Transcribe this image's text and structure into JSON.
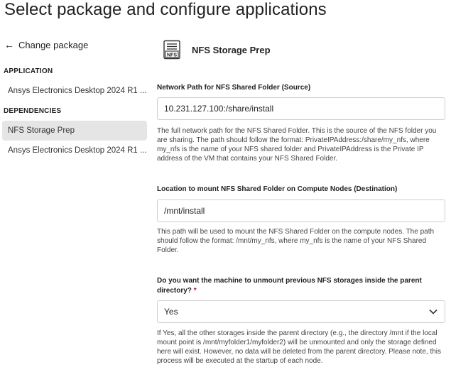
{
  "page": {
    "title": "Select package and configure applications"
  },
  "sidebar": {
    "back": {
      "label": "Change package",
      "icon": "arrow-left-icon"
    },
    "application_heading": "APPLICATION",
    "application_item": "Ansys Electronics Desktop 2024 R1 ...",
    "dependencies_heading": "DEPENDENCIES",
    "dependency_items": [
      {
        "label": "NFS Storage Prep",
        "active": true
      },
      {
        "label": "Ansys Electronics Desktop 2024 R1 ...",
        "active": false
      }
    ]
  },
  "main": {
    "package": {
      "title": "NFS Storage Prep",
      "icon": "nfs-file-icon",
      "icon_text": "NFS"
    },
    "source": {
      "label": "Network Path for NFS Shared Folder (Source)",
      "value": "10.231.127.100:/share/install",
      "helper": "The full network path for the NFS Shared Folder. This is the source of the NFS folder you are sharing. The path should follow the format: PrivateIPAddress:/share/my_nfs, where my_nfs is the name of your NFS shared folder and PrivateIPAddress is the Private IP address of the VM that contains your NFS Shared Folder."
    },
    "destination": {
      "label": "Location to mount NFS Shared Folder on Compute Nodes (Destination)",
      "value": "/mnt/install",
      "helper": "This path will be used to mount the NFS Shared Folder on the compute nodes. The path should follow the format: /mnt/my_nfs, where my_nfs is the name of your NFS Shared Folder."
    },
    "unmount": {
      "label": "Do you want the machine to unmount previous NFS storages inside the parent directory?",
      "required_mark": "*",
      "selected": "Yes",
      "helper": "If Yes, all the other storages inside the parent directory (e.g., the directory /mnt if the local mount point is /mnt/myfolder1/myfolder2) will be unmounted and only the storage defined here will exist. However, no data will be deleted from the parent directory. Please note, this process will be executed at the startup of each node."
    }
  }
}
